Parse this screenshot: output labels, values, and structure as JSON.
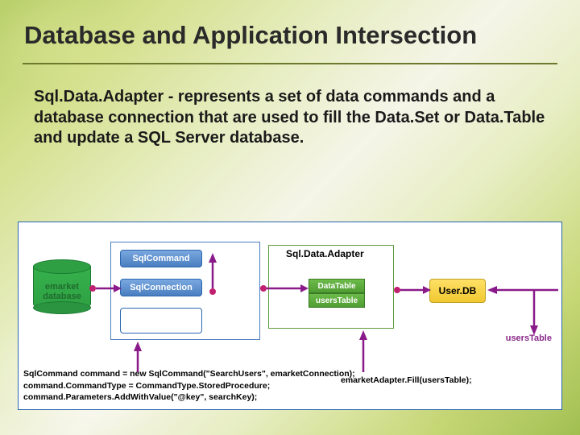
{
  "title": "Database and Application Intersection",
  "body": "Sql.Data.Adapter - represents a set of data commands and a database connection that are used to fill the Data.Set or Data.Table and update a SQL Server database.",
  "diagram": {
    "db_label": "emarket database",
    "sql_command": "SqlCommand",
    "sql_connection": "SqlConnection",
    "adapter_label": "Sql.Data.Adapter",
    "datatable": "DataTable",
    "userstable_box": "usersTable",
    "userdb": "User.DB",
    "userstable_label": "usersTable",
    "code_left_1": "SqlCommand command = new SqlCommand(\"SearchUsers\", emarketConnection);",
    "code_left_2": "command.CommandType = CommandType.StoredProcedure;",
    "code_left_3": "command.Parameters.AddWithValue(\"@key\", searchKey);",
    "code_right": "emarketAdapter.Fill(usersTable);"
  }
}
